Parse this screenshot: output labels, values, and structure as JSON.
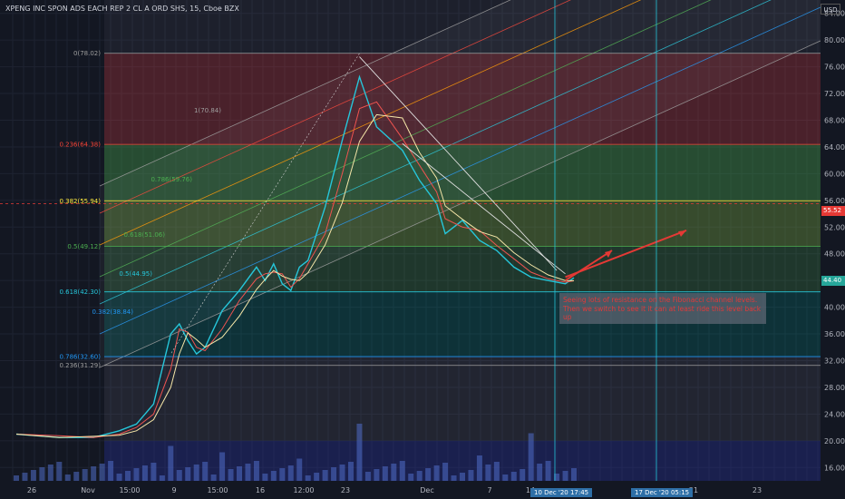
{
  "title": "XPENG INC SPON ADS EACH REP 2 CL A ORD SHS, 15, Cboe BZX",
  "currency_label": "USD",
  "note": "Seeing lots of resistance on the Fibonacci channel levels. Then we switch to see it it can at least ride this level back up",
  "cursor_tags": {
    "date1": "10 Dec '20   17:45",
    "date2": "17 Dec '20   05:15"
  },
  "price_tags": {
    "crosshair": "55.52",
    "last": "44.40"
  },
  "colors": {
    "background": "#131722",
    "candle_up": "#26a69a",
    "candle_down": "#ef5350",
    "annotation": "#e53935",
    "crosshair": "#26c6da"
  },
  "chart_data": {
    "type": "line",
    "title": "XPENG INC SPON ADS EACH REP 2 CL A ORD SHS, 15, Cboe BZX",
    "y_axis": {
      "ticks": [
        16,
        20,
        24,
        28,
        32,
        36,
        40,
        44,
        48,
        52,
        56,
        60,
        64,
        68,
        72,
        76,
        80,
        84
      ],
      "range": [
        14,
        86
      ],
      "side": "right"
    },
    "x_axis": {
      "ticks": [
        "26",
        "Nov",
        "15:00",
        "9",
        "15:00",
        "16",
        "12:00",
        "23",
        "Dec",
        "7",
        "14",
        "21",
        "23"
      ]
    },
    "fib_retracement": [
      {
        "label": "0(78.02)",
        "value": 78.02
      },
      {
        "label": "0.236(64.38)",
        "value": 64.38
      },
      {
        "label": "0.382(55.94)",
        "value": 55.94
      },
      {
        "label": "0.5(49.12)",
        "value": 49.12
      },
      {
        "label": "0.618(42.30)",
        "value": 42.3
      },
      {
        "label": "0.786(32.60)",
        "value": 32.6
      },
      {
        "label": "0.236(31.29)",
        "value": 31.29
      }
    ],
    "fib_channel_labels": [
      "1(70.84)",
      "0.786(59.76)",
      "0.618(51.06)",
      "0.5(44.95)",
      "0.382(38.84)"
    ],
    "price_series": {
      "name": "",
      "x_index": [
        0,
        5,
        9,
        12,
        14,
        16,
        18,
        19,
        20,
        21,
        22,
        24,
        26,
        28,
        29,
        30,
        31,
        32,
        33,
        34,
        36,
        38,
        40,
        42,
        45,
        47,
        49,
        50,
        52,
        54,
        56,
        58,
        60,
        62,
        64,
        65
      ],
      "values": [
        21.0,
        20.5,
        20.5,
        21.5,
        22.5,
        25.5,
        36.0,
        37.5,
        35.0,
        33.0,
        34.0,
        39.5,
        42.5,
        46.0,
        44.0,
        46.5,
        43.5,
        42.5,
        46.0,
        47.0,
        55.0,
        65.0,
        74.5,
        67.0,
        63.5,
        59.0,
        55.5,
        51.0,
        53.0,
        50.0,
        48.5,
        46.0,
        44.5,
        44.0,
        43.5,
        44.4
      ]
    },
    "volume_series": {
      "name": "Volume",
      "spikes_at_x_index": [
        18,
        24,
        33,
        40,
        54,
        60
      ],
      "relative_heights": [
        0.55,
        0.45,
        0.35,
        0.9,
        0.4,
        0.75
      ]
    },
    "annotations": [
      {
        "type": "arrow",
        "from_price": 44.0,
        "to_price": 48.5
      },
      {
        "type": "arrow",
        "from_price": 44.5,
        "to_price": 51.5
      }
    ],
    "crosshair_price": 55.52,
    "last_price": 44.4,
    "grid": true
  }
}
